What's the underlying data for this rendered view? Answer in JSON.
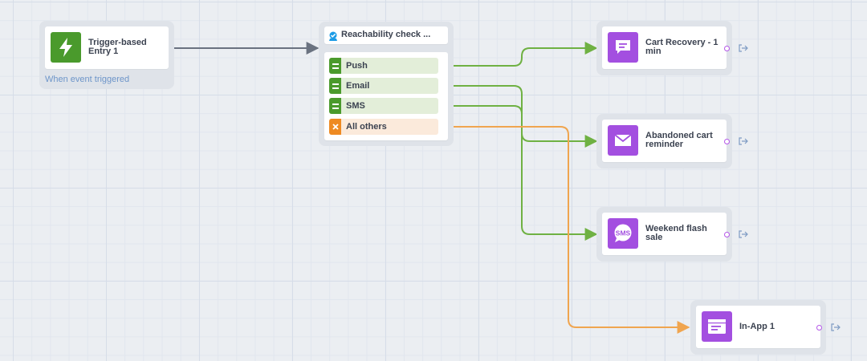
{
  "trigger_node": {
    "title": "Trigger-based Entry 1",
    "subtitle": "When event triggered",
    "icon": "lightning-icon"
  },
  "check_node": {
    "title": "Reachability check ...",
    "icon": "reachability-icon",
    "rows": [
      {
        "label": "Push",
        "kind": "match"
      },
      {
        "label": "Email",
        "kind": "match"
      },
      {
        "label": "SMS",
        "kind": "match"
      },
      {
        "label": "All others",
        "kind": "fallback"
      }
    ]
  },
  "action_nodes": [
    {
      "title": "Cart Recovery - 1 min",
      "icon": "push-message-icon"
    },
    {
      "title": "Abandoned cart reminder",
      "icon": "envelope-icon"
    },
    {
      "title": "Weekend flash sale",
      "icon": "sms-bubble-icon"
    },
    {
      "title": "In-App 1",
      "icon": "in-app-icon"
    }
  ],
  "colors": {
    "match": "#6fb143",
    "fallback": "#f0a54f",
    "link": "#6a7280",
    "action_icon": "#a34fe0",
    "trigger_icon": "#4a9a2c"
  }
}
